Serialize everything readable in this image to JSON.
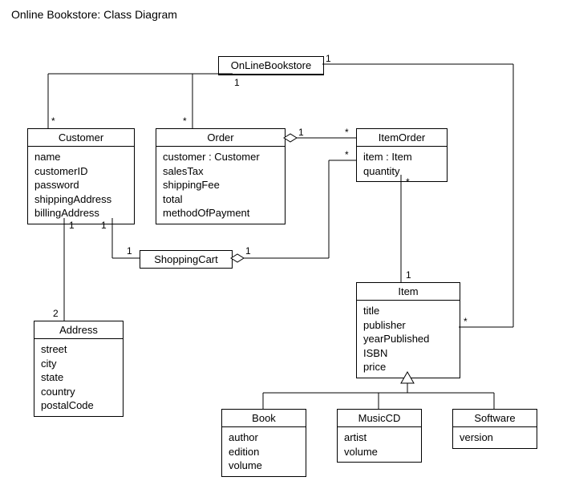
{
  "title": "Online Bookstore: Class Diagram",
  "classes": {
    "OnLineBookstore": {
      "name": "OnLineBookstore",
      "attrs": []
    },
    "Customer": {
      "name": "Customer",
      "attrs": [
        "name",
        "customerID",
        "password",
        "shippingAddress",
        "billingAddress"
      ]
    },
    "Order": {
      "name": "Order",
      "attrs": [
        "customer : Customer",
        "salesTax",
        "shippingFee",
        "total",
        "methodOfPayment"
      ]
    },
    "ItemOrder": {
      "name": "ItemOrder",
      "attrs": [
        "item : Item",
        "quantity"
      ]
    },
    "ShoppingCart": {
      "name": "ShoppingCart",
      "attrs": []
    },
    "Address": {
      "name": "Address",
      "attrs": [
        "street",
        "city",
        "state",
        "country",
        "postalCode"
      ]
    },
    "Item": {
      "name": "Item",
      "attrs": [
        "title",
        "publisher",
        "yearPublished",
        "ISBN",
        "price"
      ]
    },
    "Book": {
      "name": "Book",
      "attrs": [
        "author",
        "edition",
        "volume"
      ]
    },
    "MusicCD": {
      "name": "MusicCD",
      "attrs": [
        "artist",
        "volume"
      ]
    },
    "Software": {
      "name": "Software",
      "attrs": [
        "version"
      ]
    }
  },
  "mult": {
    "star": "*",
    "one": "1",
    "two": "2"
  },
  "relations": [
    {
      "from": "OnLineBookstore",
      "to": "Customer",
      "type": "assoc",
      "from_mult": "1",
      "to_mult": "*"
    },
    {
      "from": "OnLineBookstore",
      "to": "Order",
      "type": "assoc",
      "from_mult": "1",
      "to_mult": "*"
    },
    {
      "from": "OnLineBookstore",
      "to": "Item",
      "type": "assoc",
      "from_mult": "1",
      "to_mult": "*"
    },
    {
      "from": "Customer",
      "to": "Address",
      "type": "assoc",
      "from_mult": "1",
      "to_mult": "2"
    },
    {
      "from": "Customer",
      "to": "ShoppingCart",
      "type": "assoc",
      "from_mult": "1",
      "to_mult": "1"
    },
    {
      "from": "Order",
      "to": "ItemOrder",
      "type": "aggregation",
      "from_mult": "1",
      "to_mult": "*"
    },
    {
      "from": "ShoppingCart",
      "to": "ItemOrder",
      "type": "aggregation",
      "from_mult": "1",
      "to_mult": "*"
    },
    {
      "from": "ItemOrder",
      "to": "Item",
      "type": "assoc",
      "from_mult": "*",
      "to_mult": "1"
    },
    {
      "from": "Book",
      "to": "Item",
      "type": "generalization"
    },
    {
      "from": "MusicCD",
      "to": "Item",
      "type": "generalization"
    },
    {
      "from": "Software",
      "to": "Item",
      "type": "generalization"
    }
  ]
}
